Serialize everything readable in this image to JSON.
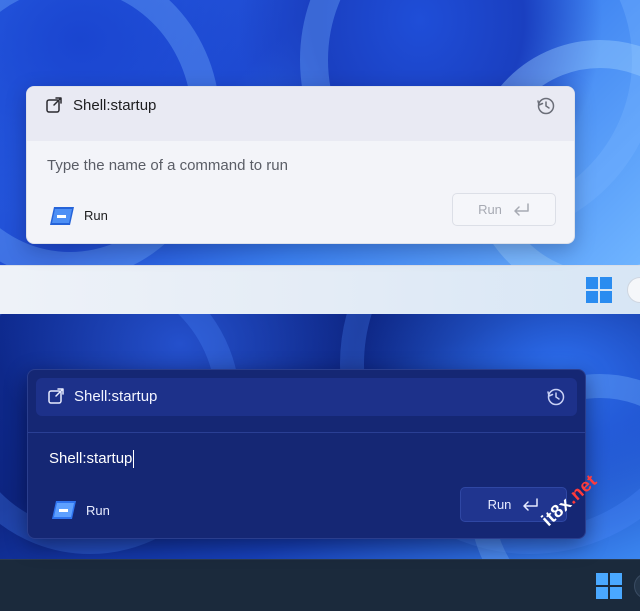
{
  "light_dialog": {
    "title": "Shell:startup",
    "input_placeholder": "Type the name of a command to run",
    "app_label": "Run",
    "run_button_label": "Run"
  },
  "dark_dialog": {
    "title": "Shell:startup",
    "input_value": "Shell:startup",
    "app_label": "Run",
    "run_button_label": "Run"
  },
  "watermark": {
    "prefix": "it8x",
    "suffix": ".net"
  },
  "colors": {
    "light_dialog_bg": "#f3f4f9",
    "dark_dialog_bg": "#152774",
    "accent_blue": "#2a8cf0"
  },
  "icons": {
    "open": "open-external-icon",
    "history": "history-icon",
    "app": "run-app-icon",
    "enter": "enter-icon",
    "start": "windows-start-icon"
  }
}
